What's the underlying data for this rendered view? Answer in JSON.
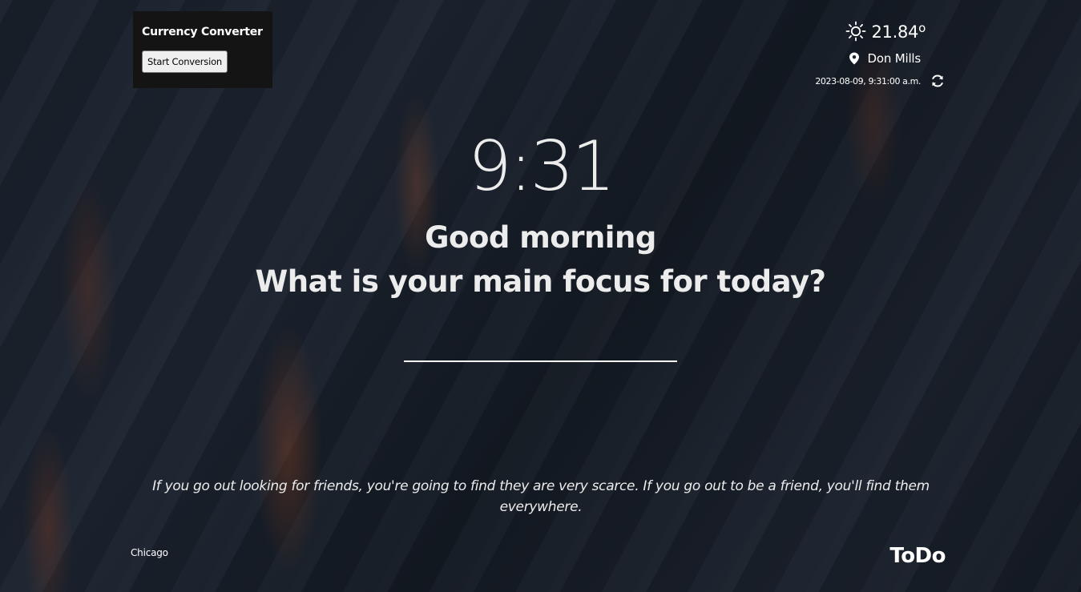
{
  "currency_widget": {
    "title": "Currency Converter",
    "button_label": "Start Conversion"
  },
  "weather": {
    "temperature": "21.84",
    "degree_symbol": "o",
    "weather_icon": "sun-icon",
    "location_icon": "pin-icon",
    "location": "Don Mills",
    "datetime": "2023-08-09, 9:31:00 a.m.",
    "refresh_icon": "refresh-icon"
  },
  "main": {
    "time": "9:31",
    "greeting": "Good morning",
    "focus_question": "What is your main focus for today?",
    "focus_input_value": ""
  },
  "quote": {
    "text": "If you go out looking for friends, you're going to find they are very scarce. If you go out to be a friend, you'll find them everywhere."
  },
  "footer": {
    "author": "Chicago",
    "todo_label": "ToDo"
  },
  "colors": {
    "background": "#171d26",
    "text": "#ececec",
    "widget_background": "#141414",
    "button_background": "#efefef"
  }
}
